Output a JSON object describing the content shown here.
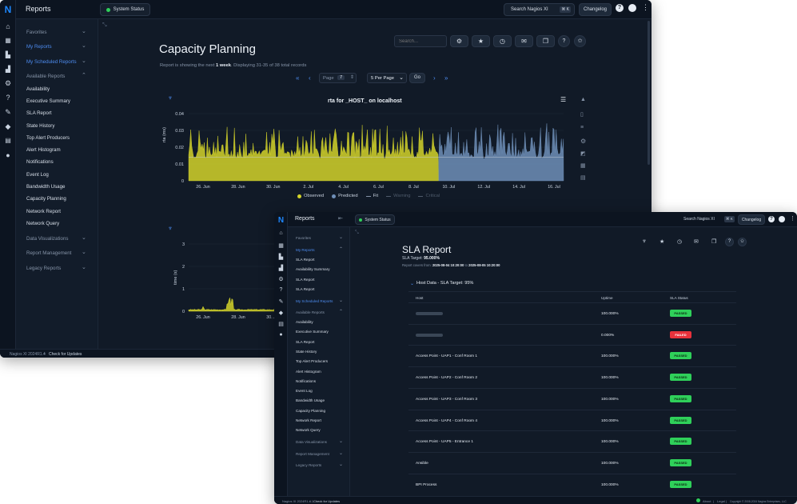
{
  "win1": {
    "app_title": "Reports",
    "status_label": "System Status",
    "search_label": "Search Nagios XI",
    "kbd": "⌘ K",
    "changelog": "Changelog",
    "sidebar": {
      "favorites": "Favorites",
      "my_reports": "My Reports",
      "my_scheduled": "My Scheduled Reports",
      "available": "Available Reports",
      "items": [
        "Availability",
        "Executive Summary",
        "SLA Report",
        "State History",
        "Top Alert Producers",
        "Alert Histogram",
        "Notifications",
        "Event Log",
        "Bandwidth Usage",
        "Capacity Planning",
        "Network Report",
        "Network Query"
      ],
      "data_viz": "Data Visualizations",
      "report_mgmt": "Report Management",
      "legacy": "Legacy Reports"
    },
    "page_title": "Capacity Planning",
    "search_placeholder": "Search...",
    "summary_prefix": "Report is showing the next",
    "summary_bold": "1 week",
    "summary_suffix": ". Displaying 31-35 of 38 total records",
    "page_label": "Page",
    "page_num": "7",
    "per_page": "5 Per Page",
    "go": "Go",
    "chart_title": "rta for _HOST_ on localhost",
    "chart_ylabel": "rta (ms)",
    "chart_yticks": [
      "0.04",
      "0.03",
      "0.02",
      "0.01",
      "0"
    ],
    "chart_xticks": [
      "26. Jun",
      "28. Jun",
      "30. Jun",
      "2. Jul",
      "4. Jul",
      "6. Jul",
      "8. Jul",
      "10. Jul",
      "12. Jul",
      "14. Jul",
      "16. Jul"
    ],
    "legend": [
      "Observed",
      "Predicted",
      "Fit",
      "Warning",
      "Critical"
    ],
    "chart2_ylabel": "time (s)",
    "chart2_yticks": [
      "3",
      "2",
      "1",
      "0"
    ],
    "chart2_xticks": [
      "26. Jun",
      "28. Jun",
      "30. Jun"
    ],
    "footer": "Nagios XI 2024R1.4",
    "footer_link": "Check for Updates"
  },
  "win2": {
    "app_title": "Reports",
    "status_label": "System Status",
    "search_label": "Search Nagios XI",
    "kbd": "⌘ K",
    "changelog": "Changelog",
    "sidebar": {
      "favorites": "Favorites",
      "my_reports": "My Reports",
      "my_report_items": [
        "SLA Report",
        "Availability Summary",
        "SLA Report",
        "SLA Report"
      ],
      "my_scheduled": "My Scheduled Reports",
      "available": "Available Reports",
      "items": [
        "Availability",
        "Executive Summary",
        "SLA Report",
        "State History",
        "Top Alert Producers",
        "Alert Histogram",
        "Notifications",
        "Event Log",
        "Bandwidth Usage",
        "Capacity Planning",
        "Network Report",
        "Network Query"
      ],
      "data_viz": "Data Visualizations",
      "report_mgmt": "Report Management",
      "legacy": "Legacy Reports"
    },
    "page_title": "SLA Report",
    "sla_target_label": "SLA Target:",
    "sla_target_value": "95.000%",
    "covers_prefix": "Report covers from:",
    "covers_from": "2025-08-04 10:20:00",
    "covers_to_word": "to",
    "covers_to": "2025-08-05 10:20:00",
    "section_title": "Host Data - SLA Target: 95%",
    "columns": [
      "Host",
      "Uptime",
      "SLA Status"
    ],
    "rows": [
      {
        "host": "",
        "uptime": "100.000%",
        "status": "PASSED"
      },
      {
        "host": "",
        "uptime": "0.000%",
        "status": "FAILED"
      },
      {
        "host": "Access Point - UAP1 - Conf Room 1",
        "uptime": "100.000%",
        "status": "PASSED"
      },
      {
        "host": "Access Point - UAP2 - Conf Room 2",
        "uptime": "100.000%",
        "status": "PASSED"
      },
      {
        "host": "Access Point - UAP3 - Conf Room 3",
        "uptime": "100.000%",
        "status": "PASSED"
      },
      {
        "host": "Access Point - UAP4 - Conf Room 4",
        "uptime": "100.000%",
        "status": "PASSED"
      },
      {
        "host": "Access Point - UAP5 - Entrance 1",
        "uptime": "100.000%",
        "status": "PASSED"
      },
      {
        "host": "Ansible",
        "uptime": "100.000%",
        "status": "PASSED"
      },
      {
        "host": "BPI Process",
        "uptime": "100.000%",
        "status": "PASSED"
      }
    ],
    "footer": "Nagios XI 2024R1.4.1",
    "footer_link": "Check for Updates",
    "footer_right_about": "About",
    "footer_right_legal": "Legal",
    "footer_right_copy": "Copyright © 2008-2024 Nagios Enterprises, LLC"
  },
  "colors": {
    "observed": "#d4d42a",
    "predicted": "#6f8fb8",
    "passed": "#2fd05a",
    "failed": "#e8323c",
    "accent": "#1e88ff"
  },
  "chart_data": [
    {
      "type": "area",
      "title": "rta for _HOST_ on localhost",
      "ylabel": "rta (ms)",
      "ylim": [
        0,
        0.04
      ],
      "xticks": [
        "26. Jun",
        "28. Jun",
        "30. Jun",
        "2. Jul",
        "4. Jul",
        "6. Jul",
        "8. Jul",
        "10. Jul",
        "12. Jul",
        "14. Jul",
        "16. Jul"
      ],
      "series": [
        {
          "name": "Observed",
          "baseline": 0.013,
          "peak_max": 0.03
        },
        {
          "name": "Predicted",
          "baseline": 0.013,
          "peak_max": 0.03
        }
      ]
    },
    {
      "type": "area",
      "ylabel": "time (s)",
      "ylim": [
        0,
        3
      ],
      "xticks": [
        "26. Jun",
        "28. Jun",
        "30. Jun"
      ],
      "series": [
        {
          "name": "Observed",
          "baseline": 0.05,
          "peak_max": 0.7
        }
      ]
    }
  ]
}
